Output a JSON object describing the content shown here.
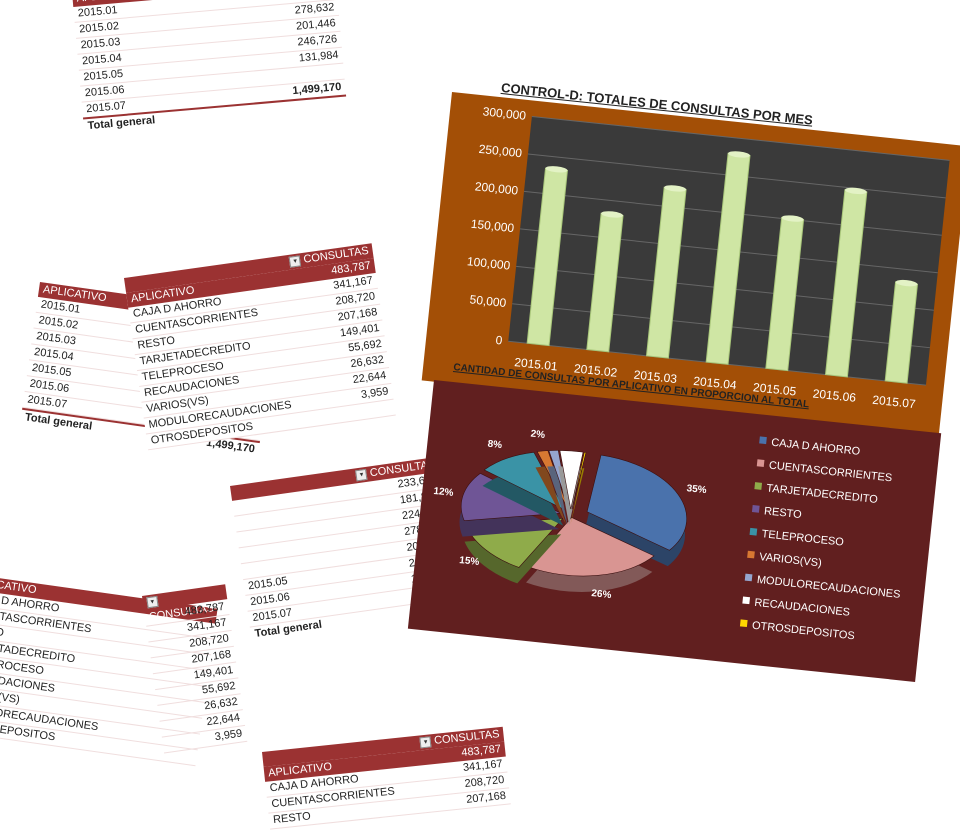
{
  "months": [
    "2015.01",
    "2015.02",
    "2015.03",
    "2015.04",
    "2015.05",
    "2015.06",
    "2015.07"
  ],
  "month_values": [
    "233,659",
    "181,845",
    "224,874",
    "278,632",
    "201,446",
    "246,726",
    "131,984"
  ],
  "total_label": "Total general",
  "total_value": "1,499,170",
  "col_aplicativo": "APLICATIVO",
  "col_consultas": "CONSULTAS",
  "apps": [
    "CAJA D AHORRO",
    "CUENTASCORRIENTES",
    "RESTO",
    "TARJETADECREDITO",
    "TELEPROCESO",
    "RECAUDACIONES",
    "VARIOS(VS)",
    "MODULORECAUDACIONES",
    "OTROSDEPOSITOS"
  ],
  "app_values": [
    "483,787",
    "341,167",
    "208,720",
    "207,168",
    "149,401",
    "55,692",
    "26,632",
    "22,644",
    "3,959"
  ],
  "chart_data": [
    {
      "type": "bar",
      "title": "CONTROL-D: TOTALES DE CONSULTAS POR MES",
      "categories": [
        "2015.01",
        "2015.02",
        "2015.03",
        "2015.04",
        "2015.05",
        "2015.06",
        "2015.07"
      ],
      "values": [
        233659,
        181845,
        224874,
        278632,
        201446,
        246726,
        131984
      ],
      "ylim": [
        0,
        300000
      ],
      "yticks": [
        "0",
        "50,000",
        "100,000",
        "150,000",
        "200,000",
        "250,000",
        "300,000"
      ],
      "grid": true,
      "colors": {
        "bars": "#cfe6a4",
        "plot": "#3a3a3a",
        "frame": "#a34f06"
      }
    },
    {
      "type": "pie",
      "title": "CANTIDAD DE CONSULTAS POR APLICATIVO EN PROPORCION AL TOTAL",
      "labels": [
        "CAJA D AHORRO",
        "CUENTASCORRIENTES",
        "TARJETADECREDITO",
        "RESTO",
        "TELEPROCESO",
        "VARIOS(VS)",
        "MODULORECAUDACIONES",
        "RECAUDACIONES",
        "OTROSDEPOSITOS"
      ],
      "values": [
        483787,
        341167,
        207168,
        208720,
        149401,
        26632,
        22644,
        55692,
        3959
      ],
      "percent_labels": [
        "35%",
        "26%",
        "15%",
        "12%",
        "8%",
        "2%",
        "",
        "",
        ""
      ],
      "colors": [
        "#4a72ac",
        "#d99592",
        "#8fab4a",
        "#6f5596",
        "#3a93a6",
        "#d77832",
        "#95a6cf",
        "#ffffff",
        "#ffd700"
      ],
      "legend": "right",
      "background": "#611f1f"
    }
  ]
}
